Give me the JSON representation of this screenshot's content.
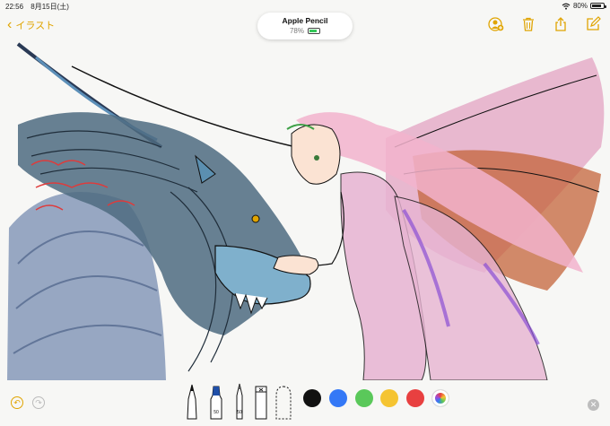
{
  "status_bar": {
    "time": "22:56",
    "date": "8月15日(土)",
    "battery_pct": "80%",
    "battery_level": 0.8
  },
  "nav": {
    "back_label": "イラスト"
  },
  "pencil": {
    "name": "Apple Pencil",
    "battery_pct": "78%",
    "battery_level": 0.78
  },
  "icons": {
    "wifi": "wifi-icon",
    "battery": "battery-icon",
    "back": "chevron-left-icon",
    "add_people": "add-person-icon",
    "trash": "trash-icon",
    "share": "share-icon",
    "compose": "compose-icon",
    "undo": "undo-icon",
    "redo": "redo-icon",
    "close": "close-icon"
  },
  "tools": {
    "items": [
      "pen",
      "marker",
      "pencil",
      "eraser",
      "lasso"
    ],
    "marker_label": "50",
    "pencil_label": "50"
  },
  "colors": {
    "accent": "#e0a400",
    "palette": [
      "#111111",
      "#3478f6",
      "#5ac85a",
      "#f5c431",
      "#e84040"
    ]
  }
}
